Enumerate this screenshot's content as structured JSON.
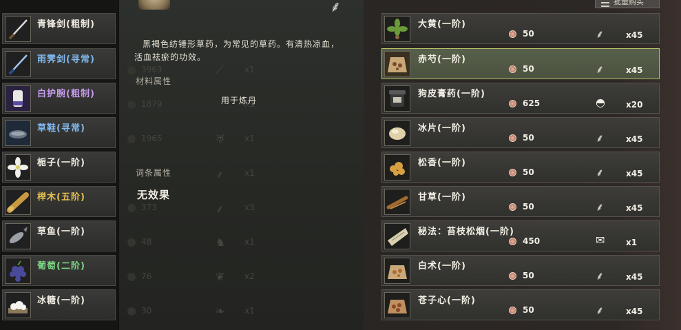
{
  "inventory": [
    {
      "name": "青锋剑(粗制)",
      "color": "#f0ece2",
      "icon": "sword-icon"
    },
    {
      "name": "雨霁剑(寻常)",
      "color": "#7fb8ee",
      "icon": "blue-sword-icon"
    },
    {
      "name": "白护腕(粗制)",
      "color": "#c69cee",
      "icon": "bracer-icon"
    },
    {
      "name": "草鞋(寻常)",
      "color": "#7fb8ee",
      "icon": "straw-sandal-icon"
    },
    {
      "name": "栀子(一阶)",
      "color": "#f0ece2",
      "icon": "gardenia-flower-icon"
    },
    {
      "name": "榉木(五阶)",
      "color": "#e4c050",
      "icon": "wood-log-icon"
    },
    {
      "name": "草鱼(一阶)",
      "color": "#f0ece2",
      "icon": "fish-icon"
    },
    {
      "name": "葡萄(二阶)",
      "color": "#7cd884",
      "icon": "grape-icon"
    },
    {
      "name": "冰糖(一阶)",
      "color": "#f0ece2",
      "icon": "rock-sugar-icon"
    }
  ],
  "detail": {
    "description": "黑褐色纺锤形草药，为常见的草药。有清热凉血，活血祛瘀的功效。",
    "material_label": "材料属性",
    "use_text": "用于炼丹",
    "affix_label": "词条属性",
    "no_effect": "无效果"
  },
  "ghost_rows": [
    {
      "num": "3969",
      "x": "x1"
    },
    {
      "num": "1879",
      "x": "x1"
    },
    {
      "num": "1965",
      "x": "x1"
    },
    {
      "num": "",
      "x": "x1"
    },
    {
      "num": "373",
      "x": "x3"
    },
    {
      "num": "48",
      "x": "x1"
    },
    {
      "num": "76",
      "x": "x2"
    },
    {
      "num": "30",
      "x": "x1"
    }
  ],
  "shop": {
    "bulk_buy_label": "批量购买",
    "items": [
      {
        "name": "大黄(一阶)",
        "price": "50",
        "qty": "x45",
        "type": "herb-root-icon",
        "icon": "rhubarb-icon",
        "selected": false
      },
      {
        "name": "赤芍(一阶)",
        "price": "50",
        "qty": "x45",
        "type": "herb-root-icon",
        "icon": "red-peony-icon",
        "selected": true
      },
      {
        "name": "狗皮膏药(一阶)",
        "price": "625",
        "qty": "x20",
        "type": "plaster-icon",
        "icon": "plaster-jar-icon",
        "selected": false
      },
      {
        "name": "冰片(一阶)",
        "price": "50",
        "qty": "x45",
        "type": "herb-root-icon",
        "icon": "borneol-icon",
        "selected": false
      },
      {
        "name": "松香(一阶)",
        "price": "50",
        "qty": "x45",
        "type": "herb-root-icon",
        "icon": "rosin-icon",
        "selected": false
      },
      {
        "name": "甘草(一阶)",
        "price": "50",
        "qty": "x45",
        "type": "herb-root-icon",
        "icon": "licorice-icon",
        "selected": false
      },
      {
        "name": "秘法：苔枝松烟(一阶)",
        "price": "450",
        "qty": "x1",
        "type": "scroll-icon",
        "icon": "secret-scroll-icon",
        "selected": false
      },
      {
        "name": "白术(一阶)",
        "price": "50",
        "qty": "x45",
        "type": "herb-root-icon",
        "icon": "atractylodes-icon",
        "selected": false
      },
      {
        "name": "苍子心(一阶)",
        "price": "50",
        "qty": "x45",
        "type": "herb-root-icon",
        "icon": "cocklebur-icon",
        "selected": false
      }
    ]
  }
}
